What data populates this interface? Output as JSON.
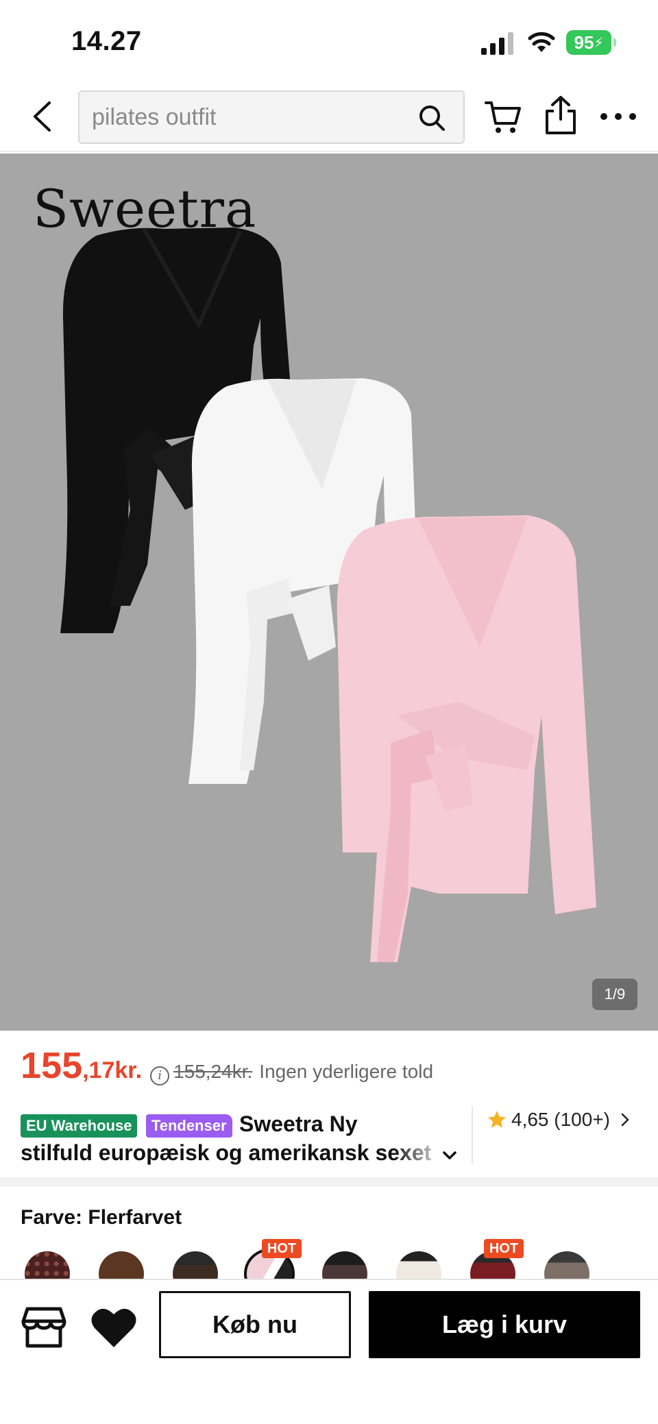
{
  "status_bar": {
    "time": "14.27",
    "battery": "95"
  },
  "nav": {
    "search_placeholder": "pilates outfit"
  },
  "product_image": {
    "brand_logo": "Sweetra",
    "counter": "1/9"
  },
  "price": {
    "main": "155",
    "decimal": ",17kr.",
    "info_icon": "i",
    "old": "155,24kr.",
    "note": "Ingen yderligere told"
  },
  "title": {
    "badges": [
      "EU Warehouse",
      "Tendenser"
    ],
    "line1": "Sweetra Ny",
    "line2": "stilfuld europæisk og amerikansk sexet"
  },
  "rating": {
    "text": "4,65 (100+)"
  },
  "color_section": {
    "label": "Farve: Flerfarvet",
    "hot_badge": "HOT",
    "swatch_colors": [
      "#5a2a26",
      "#5b3620",
      "#3e2c23",
      "#f1d0d8",
      "#3a3030",
      "#e9e1d7",
      "#7a1d22",
      "#7d6f66"
    ]
  },
  "bottom_bar": {
    "buy_now": "Køb nu",
    "add_to_cart": "Læg i kurv"
  },
  "colors": {
    "accent_red": "#e8452c",
    "eu_green": "#18925a",
    "trend_purple": "#9b5cf2",
    "hot_orange": "#ee4a22"
  }
}
